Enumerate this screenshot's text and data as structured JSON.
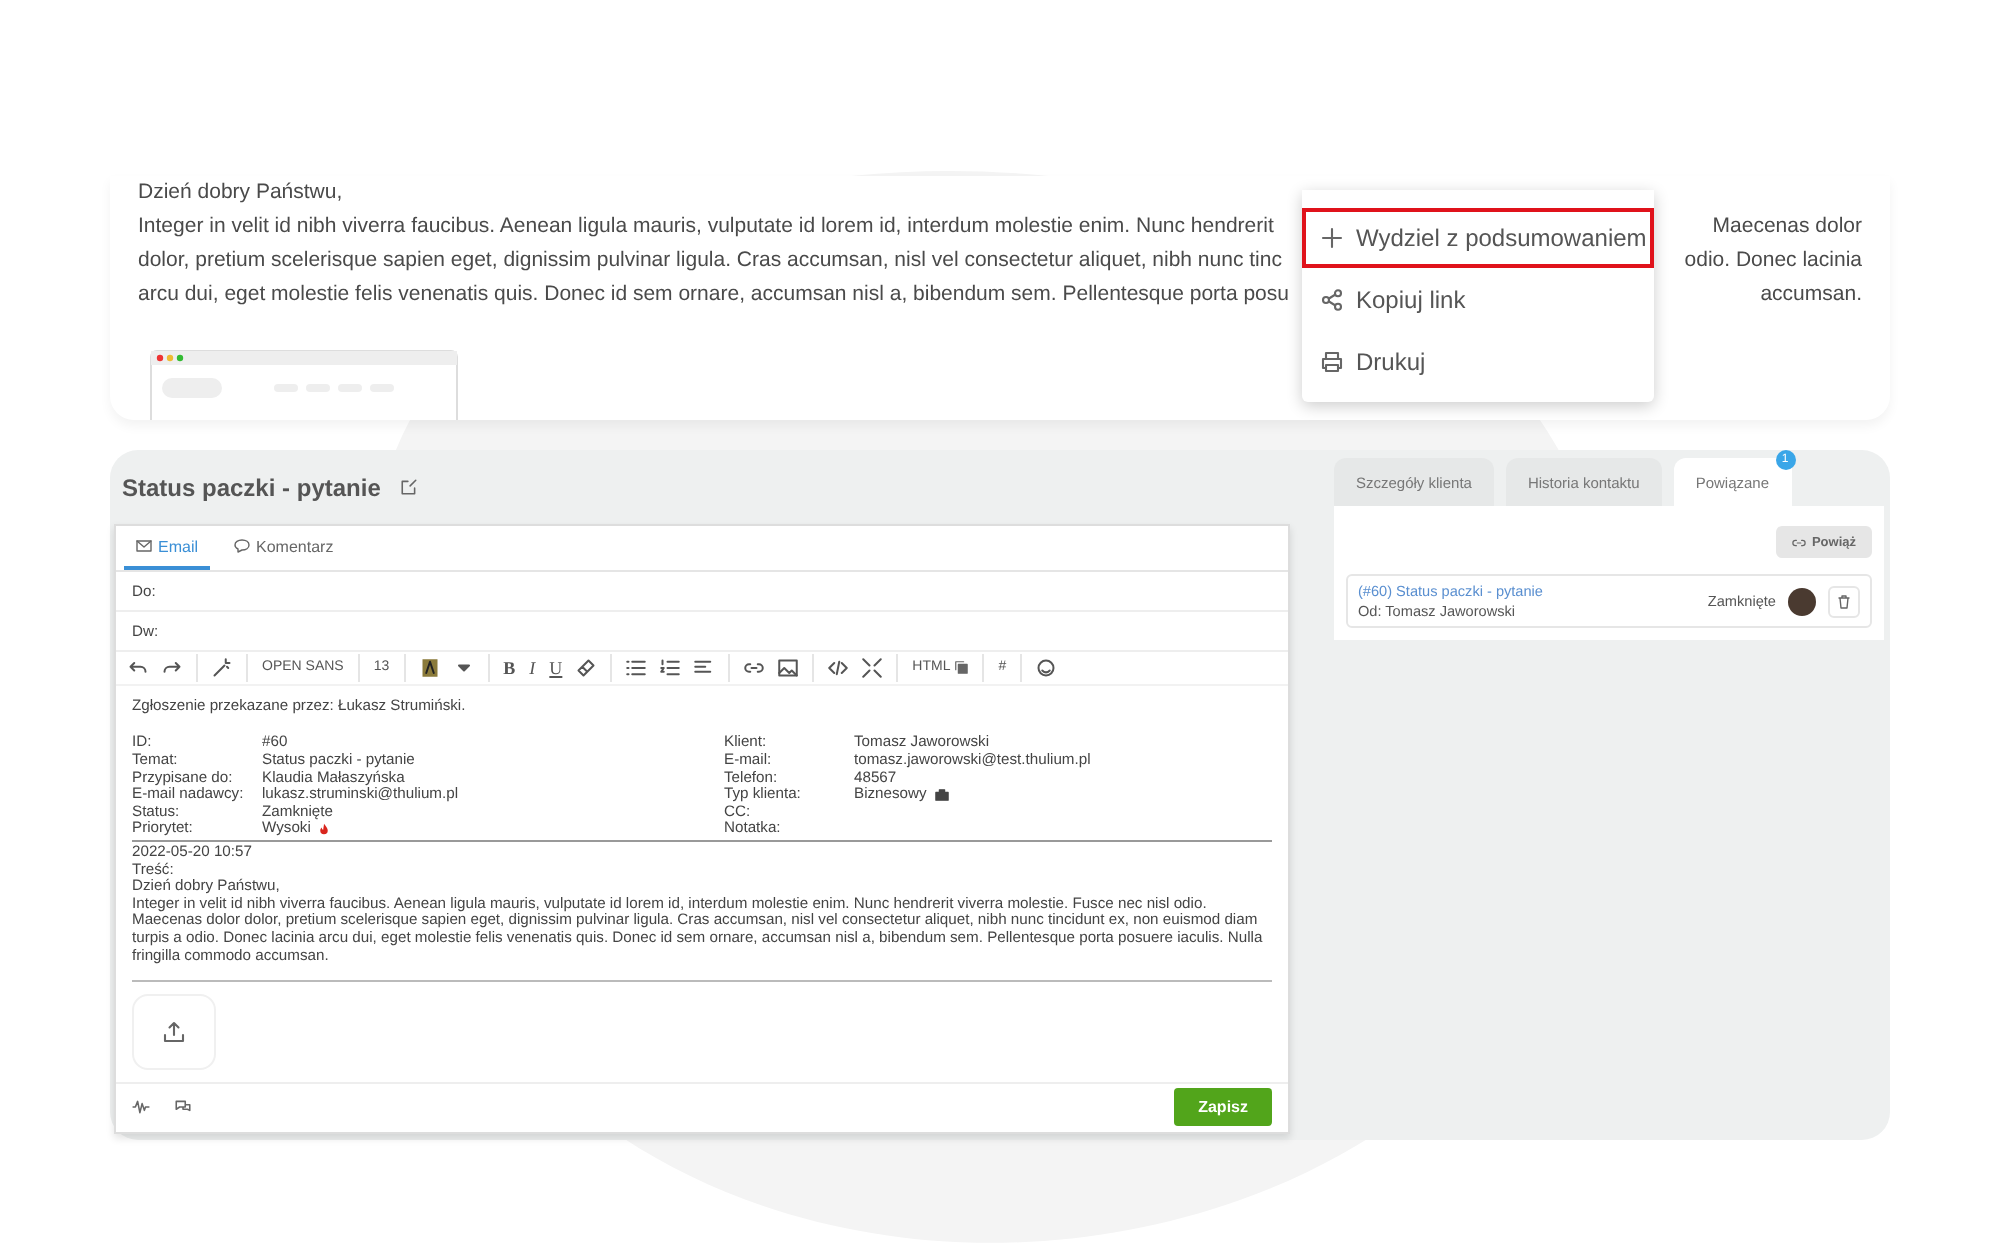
{
  "preview": {
    "greeting": "Dzień dobry Państwu,",
    "lines": [
      {
        "left": "Integer in velit id nibh viverra faucibus. Aenean ligula mauris, vulputate id lorem id, interdum molestie enim. Nunc hendrerit",
        "right": "Maecenas dolor"
      },
      {
        "left": "dolor, pretium scelerisque sapien eget, dignissim pulvinar ligula. Cras accumsan, nisl vel consectetur aliquet, nibh nunc tinc",
        "right": "odio. Donec lacinia"
      },
      {
        "left": "arcu dui, eget molestie felis venenatis quis. Donec id sem ornare, accumsan nisl a, bibendum sem. Pellentesque porta posu",
        "right": "accumsan."
      }
    ]
  },
  "context_menu": {
    "items": [
      {
        "label": "Wydziel z podsumowaniem",
        "highlighted": true
      },
      {
        "label": "Kopiuj link",
        "highlighted": false
      },
      {
        "label": "Drukuj",
        "highlighted": false
      }
    ]
  },
  "ticket": {
    "title": "Status paczki - pytanie",
    "editor": {
      "tabs": [
        {
          "label": "Email",
          "selected": true
        },
        {
          "label": "Komentarz",
          "selected": false
        }
      ],
      "fields": [
        {
          "label": "Do:"
        },
        {
          "label": "Dw:"
        }
      ],
      "toolbar": {
        "font": "OPEN SANS",
        "size": "13",
        "bold": "B",
        "italic": "I",
        "underline": "U",
        "html": "HTML",
        "hashtag": "#"
      },
      "body": {
        "forwarded": "Zgłoszenie przekazane przez: Łukasz Strumiński.",
        "left_rows": [
          {
            "label": "ID:",
            "value": "#60"
          },
          {
            "label": "Temat:",
            "value": "Status paczki - pytanie"
          },
          {
            "label": "Przypisane do:",
            "value": "Klaudia Małaszyńska"
          },
          {
            "label": "E-mail nadawcy:",
            "value": "lukasz.struminski@thulium.pl"
          },
          {
            "label": "Status:",
            "value": "Zamknięte"
          },
          {
            "label": "Priorytet:",
            "value": "Wysoki",
            "kind": "priority"
          }
        ],
        "right_rows": [
          {
            "label": "Klient:",
            "value": "Tomasz Jaworowski"
          },
          {
            "label": "E-mail:",
            "value": "tomasz.jaworowski@test.thulium.pl"
          },
          {
            "label": "Telefon:",
            "value": "48567"
          },
          {
            "label": "Typ klienta:",
            "value": "Biznesowy",
            "kind": "business"
          },
          {
            "label": "CC:"
          },
          {
            "label": "Notatka:"
          }
        ],
        "date": "2022-05-20 10:57",
        "content_label": "Treść:",
        "greeting": "Dzień dobry Państwu,",
        "paragraph": "Integer in velit id nibh viverra faucibus. Aenean ligula mauris, vulputate id lorem id, interdum molestie enim. Nunc hendrerit viverra molestie. Fusce nec nisl odio. Maecenas dolor dolor, pretium scelerisque sapien eget, dignissim pulvinar ligula. Cras accumsan, nisl vel consectetur aliquet, nibh nunc tincidunt ex, non euismod diam turpis a odio. Donec lacinia arcu dui, eget molestie felis venenatis quis. Donec id sem ornare, accumsan nisl a, bibendum sem. Pellentesque porta posuere iaculis. Nulla fringilla commodo accumsan."
      },
      "save_button": "Zapisz"
    },
    "side": {
      "tabs": [
        {
          "label": "Szczegóły klienta",
          "selected": false
        },
        {
          "label": "Historia kontaktu",
          "selected": false
        },
        {
          "label": "Powiązane",
          "selected": true,
          "badge": "1"
        }
      ],
      "link_button": "Powiąż",
      "related": [
        {
          "title": "(#60) Status paczki - pytanie",
          "from": "Od: Tomasz Jaworowski",
          "status": "Zamknięte"
        }
      ]
    }
  }
}
